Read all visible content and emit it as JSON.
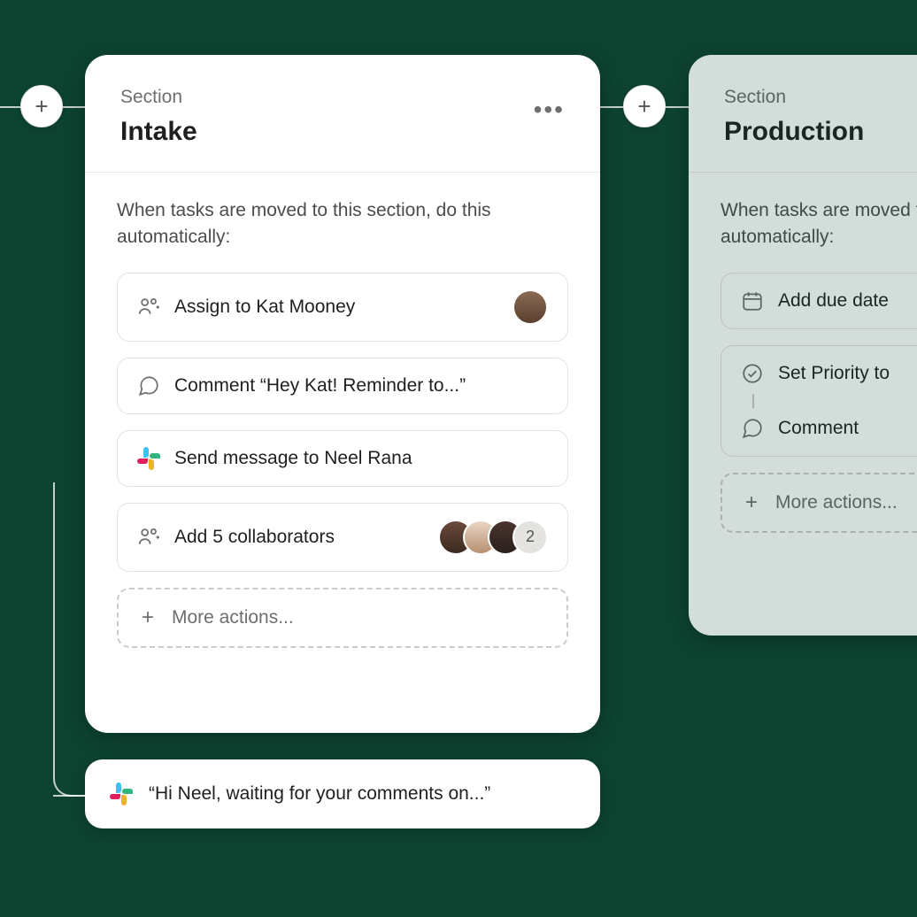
{
  "canvas": {
    "add_button_glyph": "+"
  },
  "intake": {
    "section_label": "Section",
    "title": "Intake",
    "prompt": "When tasks are moved to this section, do this automatically:",
    "rules": {
      "assign": "Assign to Kat Mooney",
      "comment": "Comment “Hey Kat! Reminder to...”",
      "slack": "Send message to Neel Rana",
      "collab": "Add 5 collaborators",
      "collab_overflow": "2"
    },
    "more_actions": "More actions..."
  },
  "production": {
    "section_label": "Section",
    "title": "Production",
    "prompt": "When tasks are moved to this section, do this automatically:",
    "rules": {
      "due": "Add due date",
      "priority": "Set Priority to",
      "comment": "Comment"
    },
    "more_actions": "More actions..."
  },
  "slack_bubble": {
    "text": "“Hi Neel, waiting for your comments on...”"
  }
}
